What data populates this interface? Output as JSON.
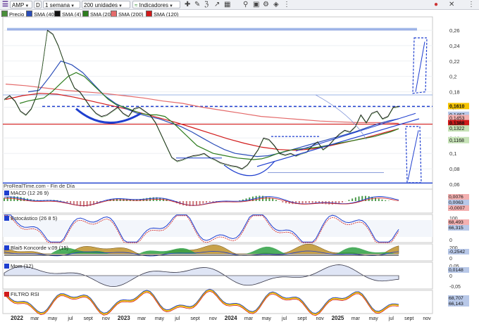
{
  "toolbar": {
    "symbol": "AMP",
    "mode": "D",
    "period": "1 semana",
    "units": "200 unidades",
    "indicators": "Indicadores"
  },
  "legend": [
    {
      "label": "Precio",
      "color": "#4a8f3a"
    },
    {
      "label": "SMA (40)",
      "color": "#2a4db8"
    },
    {
      "label": "SMA (4)",
      "color": "#111111"
    },
    {
      "label": "SMA (20)",
      "color": "#2e7d1e"
    },
    {
      "label": "SMA (200)",
      "color": "#e46a6a"
    },
    {
      "label": "SMA (120)",
      "color": "#d11a1a"
    }
  ],
  "footer_text": "ProRealTime.com - Fin de Día",
  "price_tags": [
    {
      "text": "0,1610",
      "color": "#f5c400",
      "y": 0.161
    },
    {
      "text": "0,1467",
      "color": "#b8c8e8",
      "y": 0.1497
    },
    {
      "text": "0,1453",
      "color": "#f3b0b0",
      "y": 0.1455
    },
    {
      "text": "0,1388",
      "color": "#d11a1a",
      "y": 0.1388
    },
    {
      "text": "0,1322",
      "color": "#c7e3b8",
      "y": 0.132
    },
    {
      "text": "0,1168",
      "color": "#c7e3b8",
      "y": 0.1168
    }
  ],
  "panels": [
    {
      "title": "MACD (12 26 9)",
      "values": [
        {
          "text": "0,0076",
          "color": "#f3b0b0"
        },
        {
          "text": "0,0063",
          "color": "#b8c8e8"
        },
        {
          "text": "-0,0007",
          "color": "#f3b0b0"
        }
      ]
    },
    {
      "title": "Estocástico (26 8 5)",
      "ticks": [
        "100",
        "0"
      ],
      "values": [
        {
          "text": "68,493",
          "color": "#f3b0b0"
        },
        {
          "text": "66,315",
          "color": "#b8c8e8"
        }
      ]
    },
    {
      "title": "Blai5 Koncorde v.09 (15)",
      "ticks": [
        "200",
        "0"
      ],
      "values": [
        {
          "text": "-0,2542",
          "color": "#b8c8e8"
        }
      ]
    },
    {
      "title": "Mom (12)",
      "ticks": [
        "0,05",
        "0",
        "-0,05"
      ],
      "values": [
        {
          "text": "0,0148",
          "color": "#b8c8e8"
        }
      ]
    },
    {
      "title": "FILTRO RSI",
      "values": [
        {
          "text": "68,707",
          "color": "#b8c8e8"
        },
        {
          "text": "66,143",
          "color": "#b8c8e8"
        }
      ]
    }
  ],
  "chart_data": {
    "type": "line",
    "title": "AMP",
    "x_labels": [
      "2022",
      "mar",
      "may",
      "jul",
      "sept",
      "nov",
      "2023",
      "mar",
      "may",
      "jul",
      "sept",
      "nov",
      "2024",
      "mar",
      "may",
      "jul",
      "sept",
      "nov",
      "2025",
      "mar",
      "may",
      "jul",
      "sept",
      "nov"
    ],
    "y_ticks": [
      0.26,
      0.24,
      0.22,
      0.2,
      0.18,
      0.16,
      0.14,
      0.12,
      0.1,
      0.08,
      0.06
    ],
    "ylim": [
      0.06,
      0.27
    ],
    "y_tick_labels": [
      "0,26",
      "0,24",
      "0,22",
      "0,2",
      "0,18",
      "0,16",
      "0,14",
      "0,12",
      "0,1",
      "0,08",
      "0,06"
    ],
    "last_price": 0.161,
    "series": [
      {
        "name": "Precio",
        "color": "#111111",
        "values": [
          0.17,
          0.175,
          0.168,
          0.155,
          0.15,
          0.158,
          0.175,
          0.21,
          0.26,
          0.255,
          0.24,
          0.22,
          0.2,
          0.185,
          0.18,
          0.17,
          0.16,
          0.152,
          0.148,
          0.15,
          0.155,
          0.16,
          0.152,
          0.148,
          0.158,
          0.16,
          0.155,
          0.15,
          0.14,
          0.125,
          0.11,
          0.095,
          0.09,
          0.092,
          0.095,
          0.097,
          0.098,
          0.1,
          0.095,
          0.092,
          0.088,
          0.086,
          0.084,
          0.083,
          0.08,
          0.085,
          0.095,
          0.105,
          0.12,
          0.118,
          0.11,
          0.1,
          0.098,
          0.1,
          0.097,
          0.1,
          0.102,
          0.11,
          0.115,
          0.105,
          0.11,
          0.118,
          0.125,
          0.13,
          0.128,
          0.135,
          0.15,
          0.14,
          0.152,
          0.155,
          0.145,
          0.148,
          0.16,
          0.161
        ]
      },
      {
        "name": "SMA (20)",
        "color": "#2e7d1e",
        "values": [
          0.165,
          0.168,
          0.17,
          0.172,
          0.18,
          0.19,
          0.2,
          0.205,
          0.2,
          0.19,
          0.18,
          0.17,
          0.163,
          0.16,
          0.156,
          0.152,
          0.15,
          0.15,
          0.148,
          0.14,
          0.13,
          0.12,
          0.11,
          0.105,
          0.1,
          0.098,
          0.096,
          0.094,
          0.093,
          0.092,
          0.093,
          0.096,
          0.1,
          0.103,
          0.105,
          0.106,
          0.107,
          0.108,
          0.11,
          0.112,
          0.114,
          0.116,
          0.118,
          0.12,
          0.122,
          0.125,
          0.128,
          0.132
        ]
      },
      {
        "name": "SMA (40)",
        "color": "#2a4db8",
        "values": [
          0.18,
          0.182,
          0.2,
          0.22,
          0.215,
          0.205,
          0.19,
          0.175,
          0.165,
          0.158,
          0.152,
          0.148,
          0.145,
          0.14,
          0.135,
          0.128,
          0.12,
          0.112,
          0.105,
          0.1,
          0.098,
          0.096,
          0.097,
          0.1,
          0.104,
          0.108,
          0.112,
          0.116,
          0.12,
          0.124,
          0.128,
          0.133,
          0.138,
          0.142,
          0.145
        ]
      },
      {
        "name": "SMA (120)",
        "color": "#d11a1a",
        "values": [
          0.17,
          0.175,
          0.178,
          0.177,
          0.173,
          0.168,
          0.163,
          0.158,
          0.152,
          0.146,
          0.14,
          0.133,
          0.126,
          0.119,
          0.113,
          0.108,
          0.105,
          0.104,
          0.106,
          0.11,
          0.115,
          0.12,
          0.126,
          0.132
        ]
      },
      {
        "name": "SMA (200)",
        "color": "#e46a6a",
        "values": [
          0.19,
          0.188,
          0.185,
          0.182,
          0.18,
          0.178,
          0.175,
          0.172,
          0.168,
          0.165,
          0.16,
          0.156,
          0.152,
          0.148,
          0.146,
          0.144,
          0.142,
          0.141,
          0.14,
          0.14,
          0.139
        ]
      }
    ],
    "horizontal_levels": [
      0.262,
      0.176,
      0.161,
      0.138,
      0.0615
    ]
  }
}
